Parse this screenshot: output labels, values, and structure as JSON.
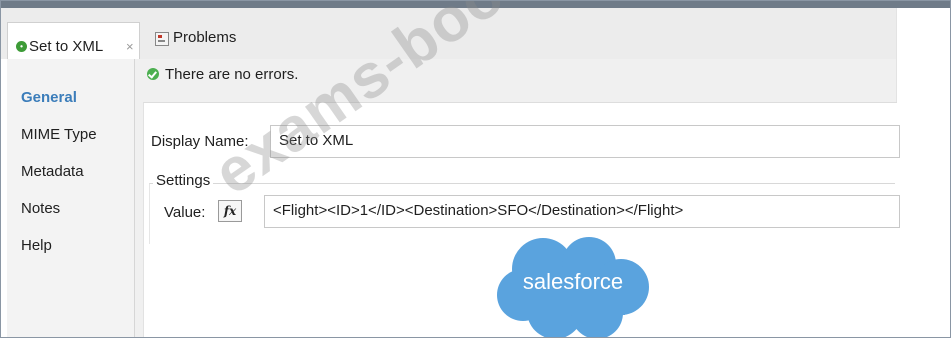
{
  "tabs": {
    "active": {
      "label": "Set to XML",
      "close_icon": "×"
    },
    "problems": {
      "label": "Problems"
    }
  },
  "status": {
    "message": "There are no errors."
  },
  "nav": {
    "items": [
      {
        "label": "General",
        "active": true
      },
      {
        "label": "MIME Type",
        "active": false
      },
      {
        "label": "Metadata",
        "active": false
      },
      {
        "label": "Notes",
        "active": false
      },
      {
        "label": "Help",
        "active": false
      }
    ]
  },
  "form": {
    "display_name_label": "Display Name:",
    "display_name_value": "Set to XML",
    "settings_label": "Settings",
    "value_label": "Value:",
    "fx_label": "fx",
    "value_text": "<Flight><ID>1</ID><Destination>SFO</Destination></Flight>"
  },
  "overlay": {
    "watermark": "exams-boost.com",
    "logo_text": "salesforce"
  },
  "colors": {
    "accent": "#3b7dba",
    "success": "#4caf50",
    "logo": "#5aa3de"
  },
  "icons": {
    "status": "check-circle-icon",
    "tab": "message-processor-icon",
    "problems": "problems-icon",
    "fx": "expression-icon"
  }
}
